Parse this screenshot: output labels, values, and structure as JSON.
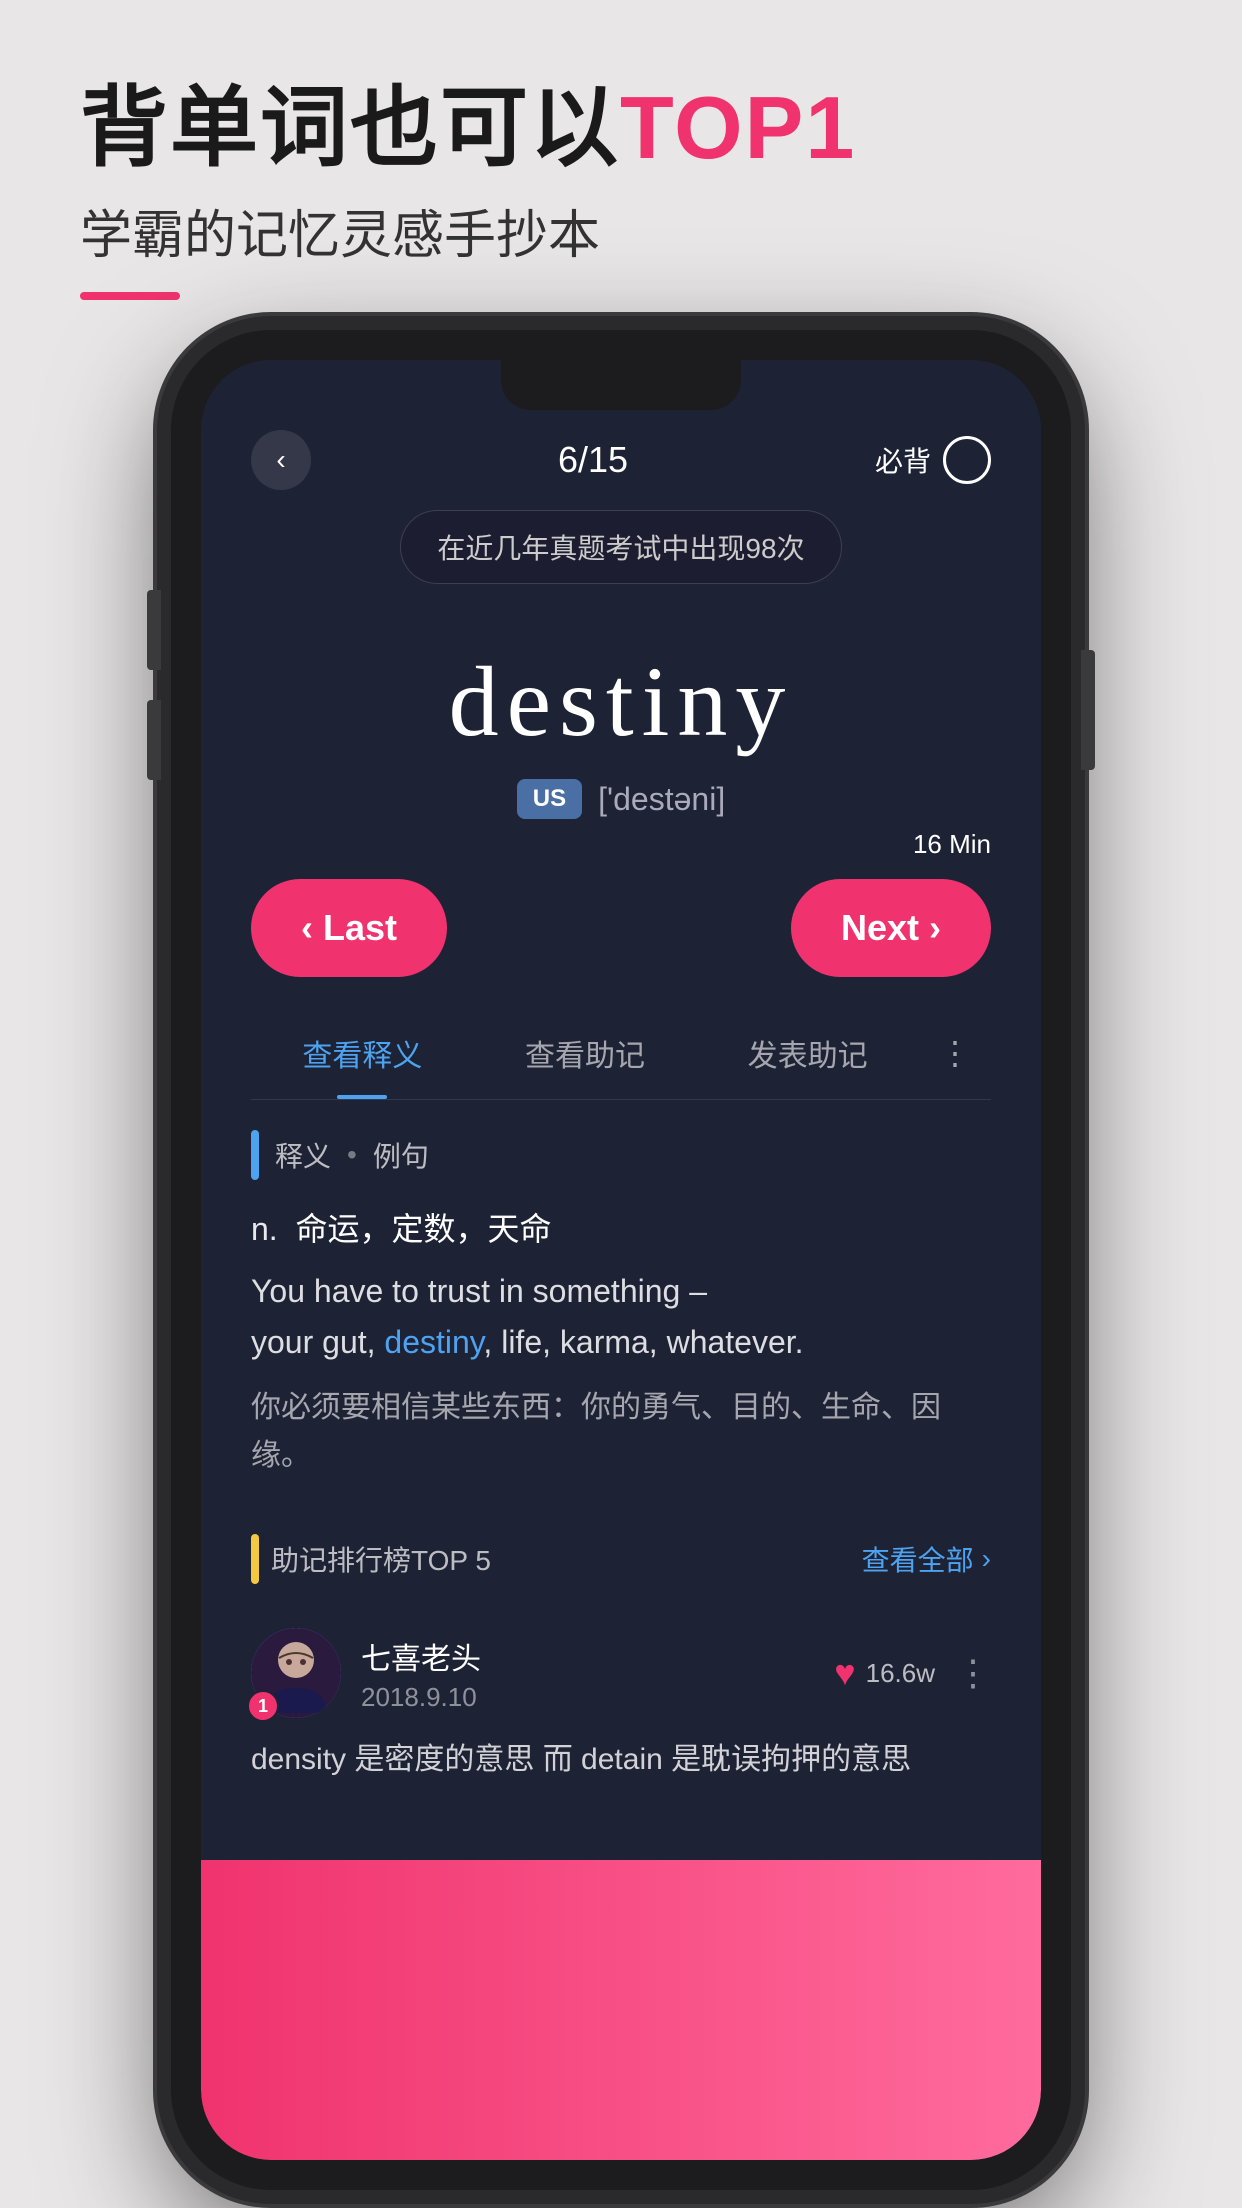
{
  "header": {
    "title_part1": "背单词也可以",
    "title_top1": "TOP1",
    "subtitle": "学霸的记忆灵感手抄本"
  },
  "phone": {
    "topbar": {
      "back": "‹",
      "progress": "6/15",
      "must_back": "必背"
    },
    "tooltip": "在近几年真题考试中出现98次",
    "word": {
      "text": "destiny",
      "us_label": "US",
      "phonetic": "['destəni]"
    },
    "time_badge": "16 Min",
    "nav": {
      "last_label": "‹ Last",
      "next_label": "Next ›"
    },
    "tabs": [
      {
        "label": "查看释义",
        "active": true
      },
      {
        "label": "查看助记",
        "active": false
      },
      {
        "label": "发表助记",
        "active": false
      }
    ],
    "def_section": {
      "label": "释义",
      "sublabel": "例句",
      "pos": "n.",
      "meaning_cn": "命运，定数，天命",
      "sentence_en_prefix": "You have to trust in something –\nyour gut, ",
      "sentence_en_highlight": "destiny",
      "sentence_en_suffix": ", life, karma, whatever.",
      "sentence_cn": "你必须要相信某些东西：你的勇气、目的、生命、因缘。"
    },
    "mnemonic_section": {
      "title": "助记排行榜TOP 5",
      "view_all": "查看全部"
    },
    "user_post": {
      "name": "七喜老头",
      "date": "2018.9.10",
      "badge": "1",
      "likes": "16.6w",
      "content": "density 是密度的意思 而 detain 是耽误拘押的意思"
    }
  }
}
